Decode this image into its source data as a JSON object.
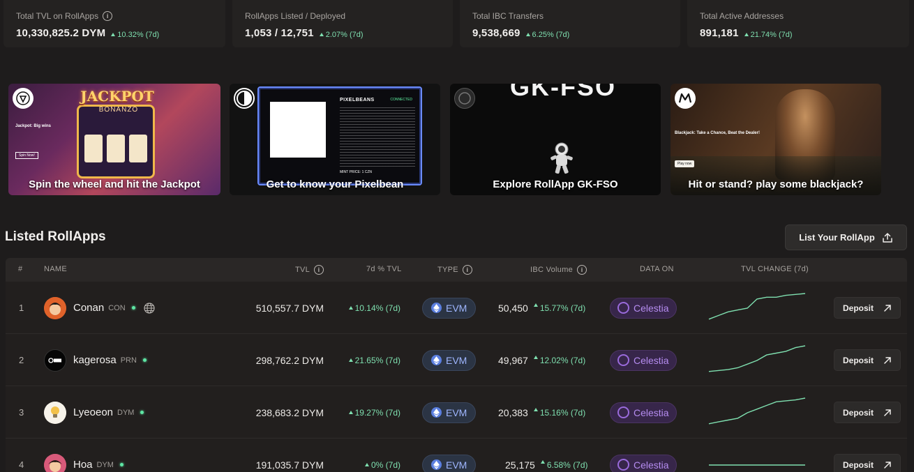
{
  "stats": [
    {
      "label": "Total TVL on RollApps",
      "value": "10,330,825.2 DYM",
      "change": "10.32% (7d)",
      "has_info": true
    },
    {
      "label": "RollApps Listed / Deployed",
      "value": "1,053 / 12,751",
      "change": "2.07% (7d)",
      "has_info": false
    },
    {
      "label": "Total IBC Transfers",
      "value": "9,538,669",
      "change": "6.25% (7d)",
      "has_info": false
    },
    {
      "label": "Total Active Addresses",
      "value": "891,181",
      "change": "21.74% (7d)",
      "has_info": false
    }
  ],
  "banners": [
    {
      "caption": "Spin the wheel and hit the Jackpot",
      "art_title": "JACKPOT",
      "art_subtitle": "BONANZO",
      "art_heading": "Jackpot: Big wins",
      "art_button": "Spin Now!"
    },
    {
      "caption": "Get to know your Pixelbean",
      "art_title": "PIXELBEANS",
      "art_status": "CONNECTED",
      "art_mint": "MINT PRICE: 1 CZN"
    },
    {
      "caption": "Explore RollApp GK-FSO",
      "art_title": "GK-FSO"
    },
    {
      "caption": "Hit or stand? play some blackjack?",
      "art_heading": "Blackjack: Take a Chance, Beat the Dealer!",
      "art_button": "Play now"
    }
  ],
  "section": {
    "title": "Listed RollApps",
    "list_button": "List Your RollApp"
  },
  "table": {
    "headers": {
      "index": "#",
      "name": "NAME",
      "tvl": "TVL",
      "tvl_change": "7d % TVL",
      "type": "TYPE",
      "ibc": "IBC Volume",
      "data_on": "DATA ON",
      "chart": "TVL CHANGE (7d)"
    },
    "rows": [
      {
        "index": "1",
        "name": "Conan",
        "ticker": "CON",
        "has_globe": true,
        "tvl": "510,557.7 DYM",
        "tvl_change": "10.14% (7d)",
        "type": "EVM",
        "ibc_volume": "50,450",
        "ibc_change": "15.77% (7d)",
        "data_on": "Celestia",
        "action": "Deposit",
        "sparkline": [
          2,
          4,
          6,
          7,
          8,
          13,
          14,
          14,
          15,
          15.5,
          16
        ]
      },
      {
        "index": "2",
        "name": "kagerosa",
        "ticker": "PRN",
        "has_globe": false,
        "tvl": "298,762.2 DYM",
        "tvl_change": "21.65% (7d)",
        "type": "EVM",
        "ibc_volume": "49,967",
        "ibc_change": "12.02% (7d)",
        "data_on": "Celestia",
        "action": "Deposit",
        "sparkline": [
          2,
          2.5,
          3,
          4,
          6,
          8,
          11,
          12,
          13,
          15,
          16
        ]
      },
      {
        "index": "3",
        "name": "Lyeoeon",
        "ticker": "DYM",
        "has_globe": false,
        "tvl": "238,683.2 DYM",
        "tvl_change": "19.27% (7d)",
        "type": "EVM",
        "ibc_volume": "20,383",
        "ibc_change": "15.16% (7d)",
        "data_on": "Celestia",
        "action": "Deposit",
        "sparkline": [
          2,
          3,
          4,
          5,
          8,
          10,
          12,
          14,
          14.5,
          15,
          16
        ]
      },
      {
        "index": "4",
        "name": "Hoa",
        "ticker": "DYM",
        "has_globe": false,
        "tvl": "191,035.7 DYM",
        "tvl_change": "0% (7d)",
        "type": "EVM",
        "ibc_volume": "25,175",
        "ibc_change": "6.58% (7d)",
        "data_on": "Celestia",
        "action": "Deposit",
        "sparkline": [
          8,
          8,
          8,
          8,
          8,
          8,
          8,
          8,
          8,
          8,
          8
        ]
      }
    ]
  },
  "colors": {
    "positive": "#7fe0b0",
    "evm": "#9fb6ff",
    "celestia": "#b58cf0"
  }
}
